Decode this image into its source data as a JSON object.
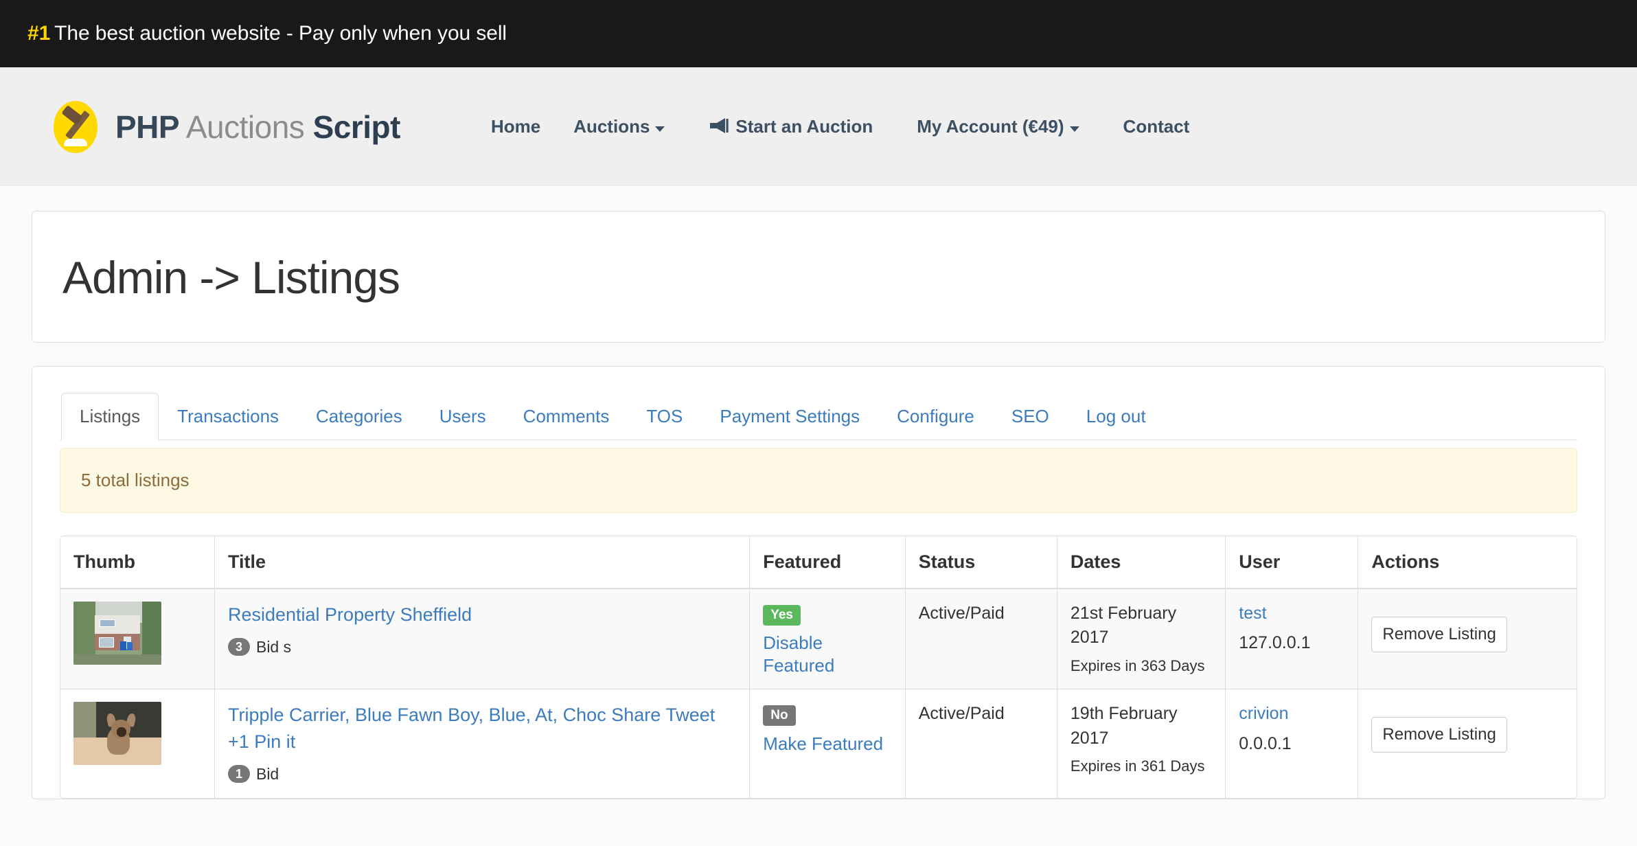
{
  "topbar": {
    "rank": "#1",
    "tagline": "The best auction website - Pay only when you sell",
    "background": "#191919",
    "rank_color": "#ffd400"
  },
  "header": {
    "brand": {
      "php": "PHP",
      "auctions": "Auctions",
      "script": "Script",
      "logo_icon": "gavel-icon",
      "logo_background": "#ffd900"
    },
    "nav": [
      {
        "label": "Home",
        "icon": null,
        "caret": false
      },
      {
        "label": "Auctions",
        "icon": null,
        "caret": true
      },
      {
        "label": "Start an Auction",
        "icon": "bullhorn-icon",
        "caret": false
      },
      {
        "label": "My Account (€49)",
        "icon": null,
        "caret": true
      },
      {
        "label": "Contact",
        "icon": null,
        "caret": false
      }
    ],
    "accent_color": "#3c4f63"
  },
  "page": {
    "title": "Admin -> Listings"
  },
  "tabs": [
    {
      "label": "Listings",
      "active": true
    },
    {
      "label": "Transactions",
      "active": false
    },
    {
      "label": "Categories",
      "active": false
    },
    {
      "label": "Users",
      "active": false
    },
    {
      "label": "Comments",
      "active": false
    },
    {
      "label": "TOS",
      "active": false
    },
    {
      "label": "Payment Settings",
      "active": false
    },
    {
      "label": "Configure",
      "active": false
    },
    {
      "label": "SEO",
      "active": false
    },
    {
      "label": "Log out",
      "active": false
    }
  ],
  "alert": {
    "text": "5 total listings",
    "background": "#fcf8e3",
    "text_color": "#8a6d3b"
  },
  "table": {
    "headers": [
      "Thumb",
      "Title",
      "Featured",
      "Status",
      "Dates",
      "User",
      "Actions"
    ],
    "rows": [
      {
        "thumb_alt": "house-thumbnail",
        "title": "Residential Property Sheffield",
        "bid_count": "3",
        "bid_label": "Bid s",
        "featured_badge": "Yes",
        "featured_badge_color": "#5cb85c",
        "featured_action": "Disable Featured",
        "status": "Active/Paid",
        "date": "21st February 2017",
        "expires": "Expires in 363 Days",
        "user": "test",
        "ip": "127.0.0.1",
        "action_button": "Remove Listing"
      },
      {
        "thumb_alt": "puppy-thumbnail",
        "title": "Tripple Carrier, Blue Fawn Boy, Blue, At, Choc Share Tweet +1 Pin it",
        "bid_count": "1",
        "bid_label": "Bid",
        "featured_badge": "No",
        "featured_badge_color": "#777777",
        "featured_action": "Make Featured",
        "status": "Active/Paid",
        "date": "19th February 2017",
        "expires": "Expires in 361 Days",
        "user": "crivion",
        "ip": "0.0.0.1",
        "action_button": "Remove Listing"
      }
    ]
  }
}
